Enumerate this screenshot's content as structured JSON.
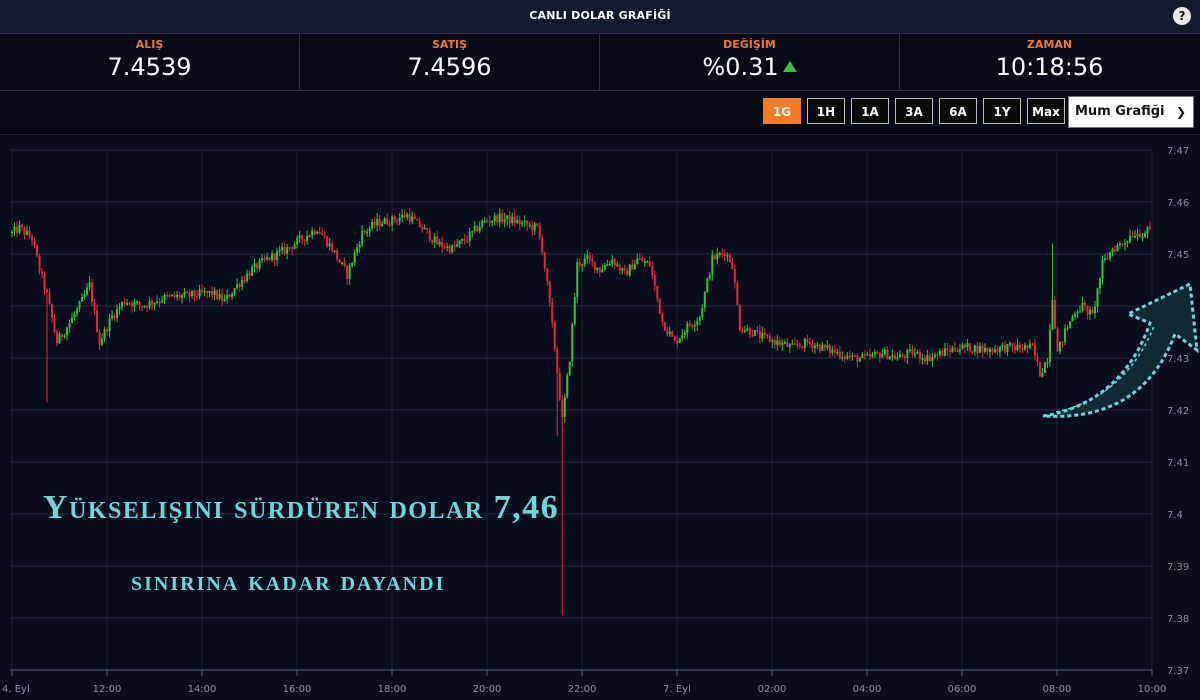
{
  "title": "CANLI DOLAR GRAFİĞİ",
  "help_label": "?",
  "stats": [
    {
      "label": "ALIŞ",
      "value": "7.4539"
    },
    {
      "label": "SATIŞ",
      "value": "7.4596"
    },
    {
      "label": "DEĞİŞİM",
      "value": "%0.31"
    },
    {
      "label": "ZAMAN",
      "value": "10:18:56"
    }
  ],
  "ranges": [
    "1G",
    "1H",
    "1A",
    "3A",
    "6A",
    "1Y",
    "Max"
  ],
  "active_range": "1G",
  "chart_type_select": "Mum Grafiği",
  "colors": {
    "up": "#35c23e",
    "down": "#e3283a",
    "accent": "#f07b28",
    "overlay_text": "#6fd6de",
    "background": "#0a0e1c"
  },
  "overlay": {
    "line1": "Yükselişini sürdüren dolar 7,46",
    "line2": "sınırına kadar dayandı"
  },
  "chart_data": {
    "type": "candlestick",
    "y_ticks": [
      "7.47",
      "7.46",
      "7.45",
      "7.44",
      "7.43",
      "7.42",
      "7.41",
      "7.4",
      "7.39",
      "7.38",
      "7.37"
    ],
    "y_range": [
      7.37,
      7.47
    ],
    "x_ticks": [
      "4. Eyl",
      "12:00",
      "14:00",
      "16:00",
      "18:00",
      "20:00",
      "22:00",
      "7. Eyl",
      "02:00",
      "04:00",
      "06:00",
      "08:00",
      "10:00"
    ],
    "grid": true,
    "path": [
      [
        0,
        7.454
      ],
      [
        3,
        7.455
      ],
      [
        8,
        7.453
      ],
      [
        11,
        7.447
      ],
      [
        14,
        7.442
      ],
      [
        18,
        7.433
      ],
      [
        22,
        7.436
      ],
      [
        27,
        7.44
      ],
      [
        31,
        7.444
      ],
      [
        35,
        7.433
      ],
      [
        40,
        7.438
      ],
      [
        45,
        7.441
      ],
      [
        52,
        7.44
      ],
      [
        60,
        7.4415
      ],
      [
        70,
        7.442
      ],
      [
        80,
        7.4425
      ],
      [
        85,
        7.441
      ],
      [
        90,
        7.444
      ],
      [
        96,
        7.447
      ],
      [
        102,
        7.449
      ],
      [
        110,
        7.451
      ],
      [
        116,
        7.453
      ],
      [
        122,
        7.455
      ],
      [
        128,
        7.451
      ],
      [
        134,
        7.446
      ],
      [
        140,
        7.454
      ],
      [
        146,
        7.456
      ],
      [
        152,
        7.4565
      ],
      [
        158,
        7.4575
      ],
      [
        164,
        7.455
      ],
      [
        170,
        7.452
      ],
      [
        176,
        7.451
      ],
      [
        182,
        7.453
      ],
      [
        188,
        7.456
      ],
      [
        194,
        7.457
      ],
      [
        200,
        7.4565
      ],
      [
        206,
        7.4555
      ],
      [
        210,
        7.455
      ],
      [
        212,
        7.451
      ],
      [
        214,
        7.444
      ],
      [
        217,
        7.432
      ],
      [
        220,
        7.418
      ],
      [
        223,
        7.43
      ],
      [
        226,
        7.448
      ],
      [
        230,
        7.449
      ],
      [
        235,
        7.447
      ],
      [
        240,
        7.449
      ],
      [
        245,
        7.446
      ],
      [
        250,
        7.449
      ],
      [
        255,
        7.448
      ],
      [
        260,
        7.437
      ],
      [
        265,
        7.433
      ],
      [
        270,
        7.436
      ],
      [
        275,
        7.438
      ],
      [
        280,
        7.449
      ],
      [
        285,
        7.4505
      ],
      [
        288,
        7.448
      ],
      [
        291,
        7.436
      ],
      [
        296,
        7.435
      ],
      [
        300,
        7.434
      ],
      [
        306,
        7.433
      ],
      [
        312,
        7.432
      ],
      [
        318,
        7.433
      ],
      [
        324,
        7.432
      ],
      [
        330,
        7.431
      ],
      [
        336,
        7.43
      ],
      [
        342,
        7.43
      ],
      [
        348,
        7.431
      ],
      [
        354,
        7.43
      ],
      [
        360,
        7.431
      ],
      [
        366,
        7.43
      ],
      [
        372,
        7.431
      ],
      [
        378,
        7.432
      ],
      [
        384,
        7.432
      ],
      [
        390,
        7.4315
      ],
      [
        396,
        7.432
      ],
      [
        402,
        7.432
      ],
      [
        408,
        7.432
      ],
      [
        411,
        7.427
      ],
      [
        414,
        7.43
      ],
      [
        416,
        7.442
      ],
      [
        418,
        7.431
      ],
      [
        421,
        7.435
      ],
      [
        425,
        7.439
      ],
      [
        428,
        7.44
      ],
      [
        432,
        7.438
      ],
      [
        436,
        7.448
      ],
      [
        440,
        7.451
      ],
      [
        444,
        7.452
      ],
      [
        448,
        7.454
      ],
      [
        452,
        7.454
      ],
      [
        455,
        7.4545
      ]
    ]
  }
}
